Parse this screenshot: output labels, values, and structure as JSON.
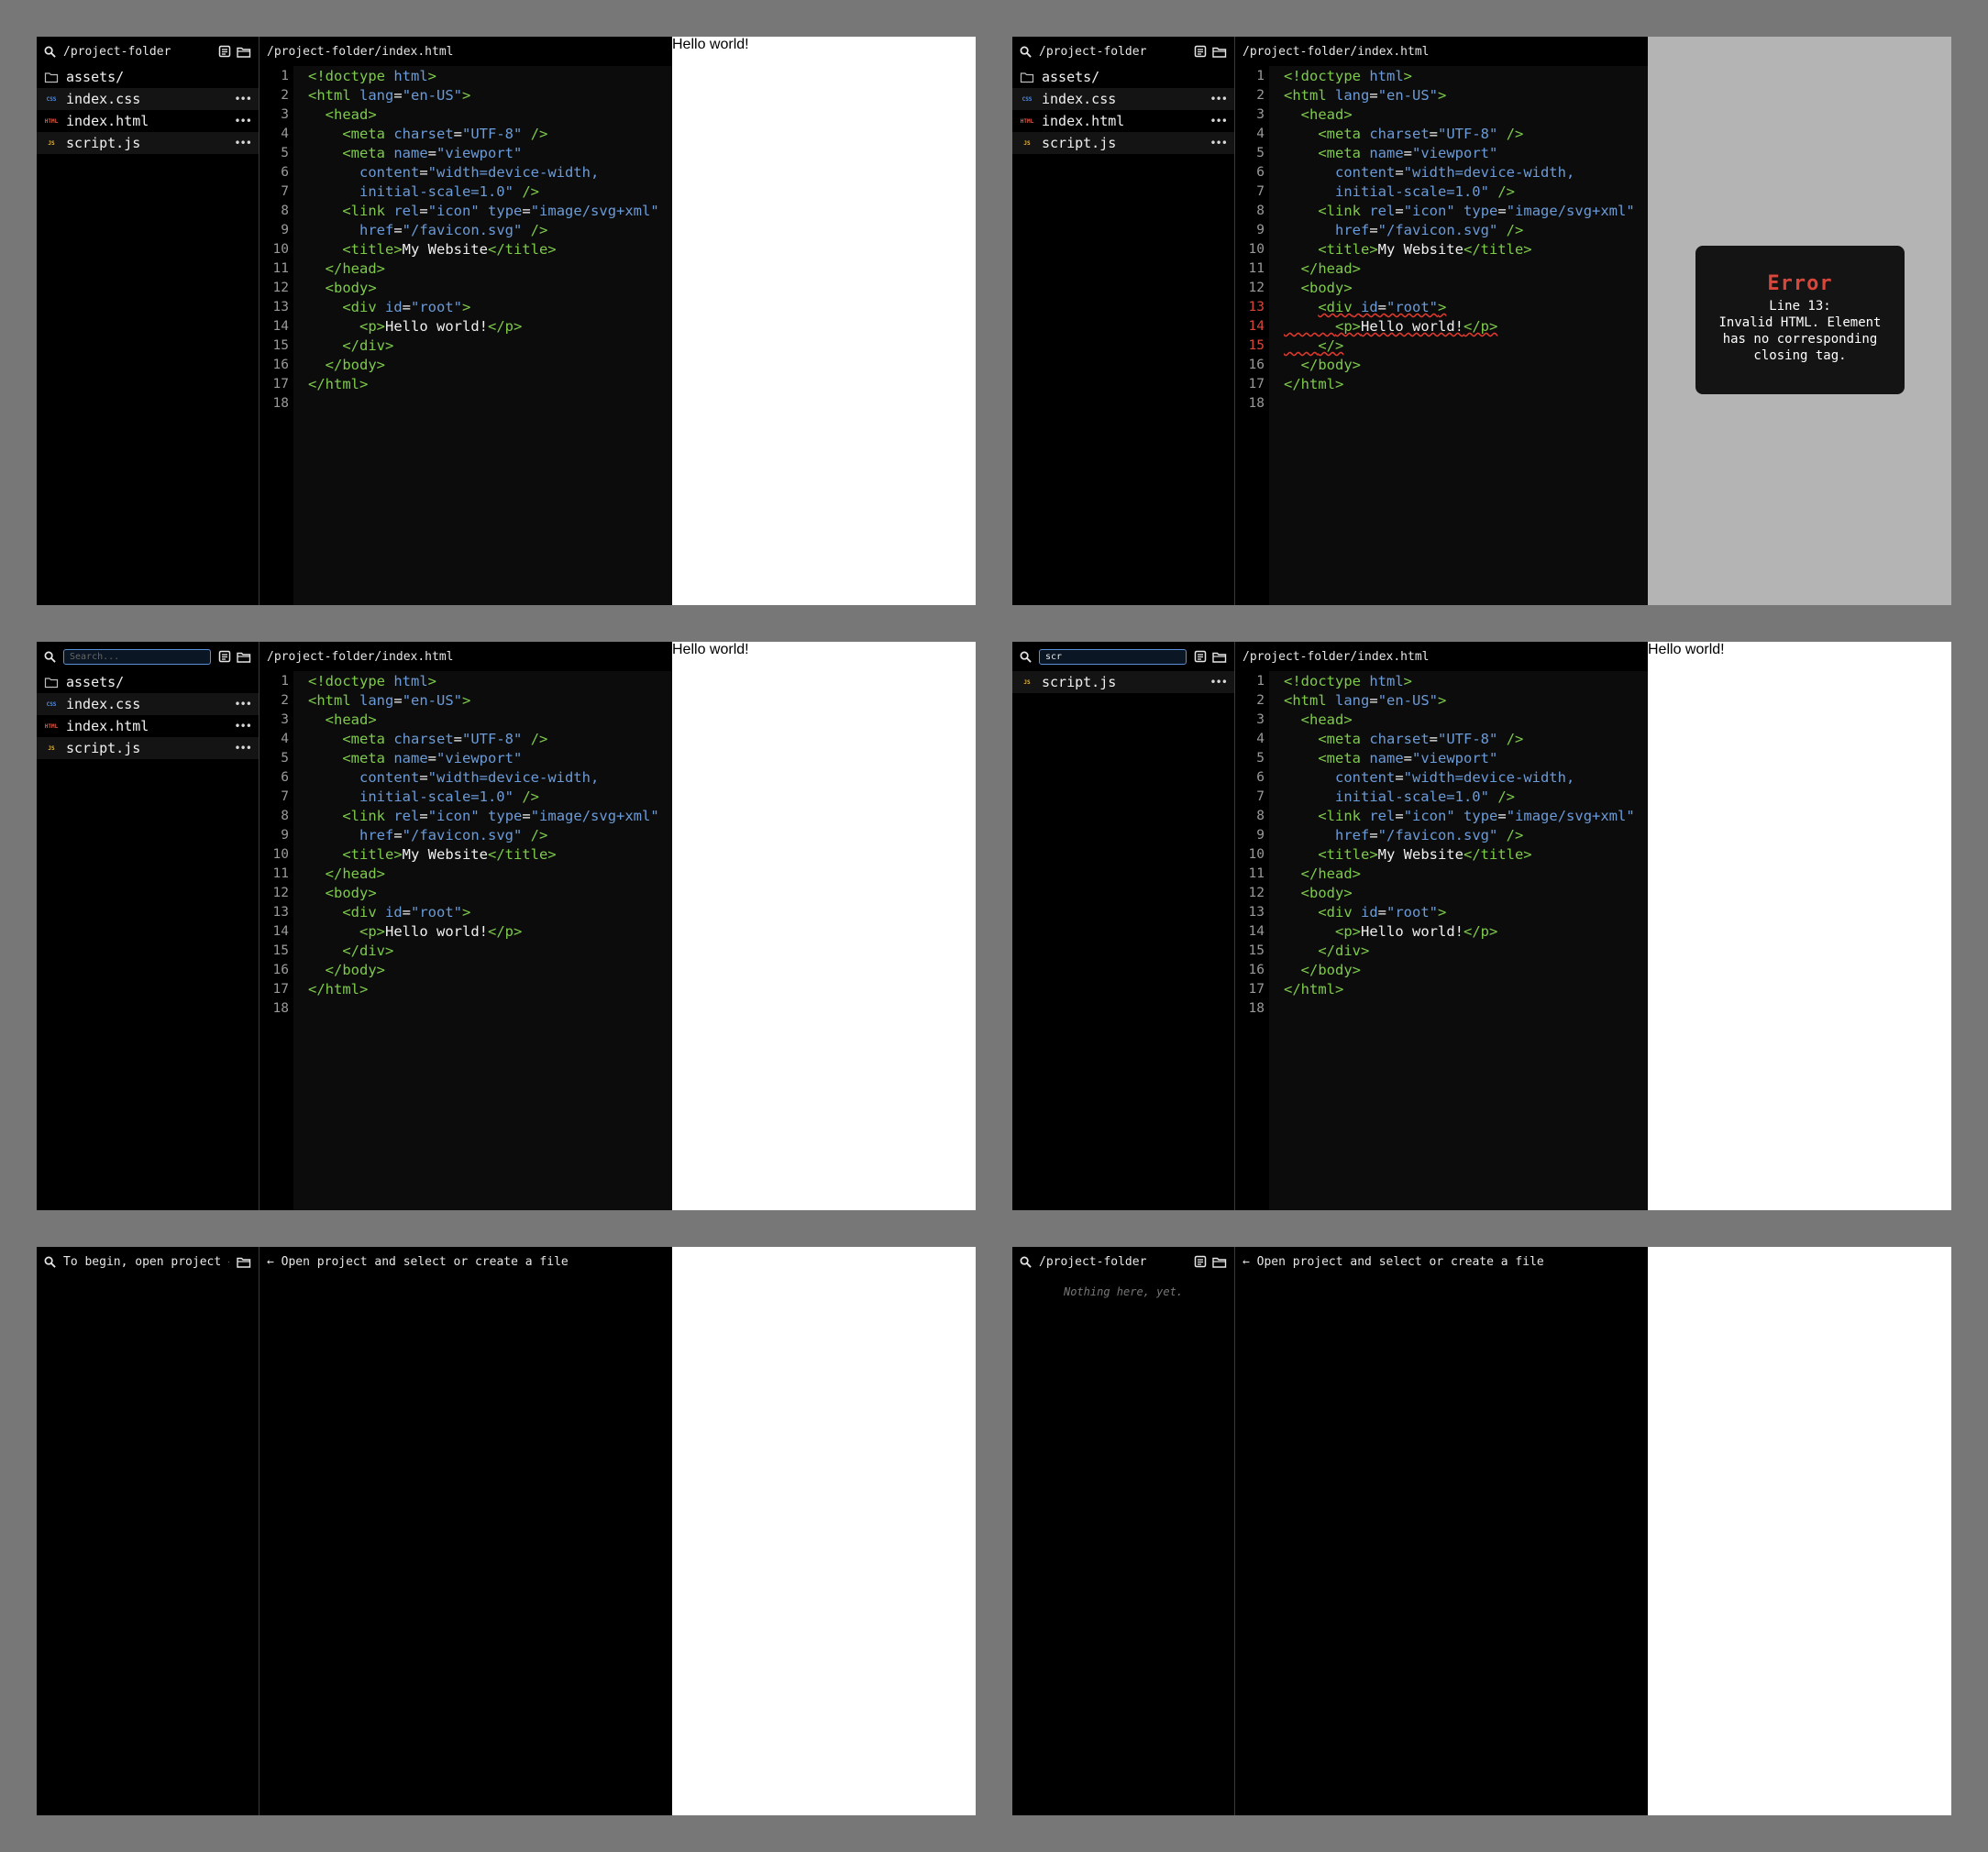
{
  "project_path": "/project-folder",
  "file_path": "/project-folder/index.html",
  "files": [
    {
      "name": "assets/",
      "icon": "folder-icon"
    },
    {
      "name": "index.css",
      "icon": "css-file-icon",
      "badge": "CSS"
    },
    {
      "name": "index.html",
      "icon": "html-file-icon",
      "badge": "HTML"
    },
    {
      "name": "script.js",
      "icon": "js-file-icon",
      "badge": "JS"
    }
  ],
  "line_numbers": [
    "1",
    "2",
    "3",
    "4",
    "5",
    "6",
    "7",
    "8",
    "9",
    "10",
    "11",
    "12",
    "13",
    "14",
    "15",
    "16",
    "17",
    "18"
  ],
  "preview_text": "Hello world!",
  "search": {
    "placeholder": "Search...",
    "query": "scr"
  },
  "error": {
    "title": "Error",
    "message": "Line 13:\nInvalid HTML. Element\nhas no corresponding\nclosing tag."
  },
  "empty": {
    "sidebar_hint": "To begin, open project →",
    "editor_hint": "← Open project and select or create a file",
    "no_files": "Nothing here, yet."
  },
  "colors": {
    "background": "#777777",
    "tag": "#7ecb4b",
    "attribute": "#6b9bd8",
    "error": "#d9463b"
  }
}
